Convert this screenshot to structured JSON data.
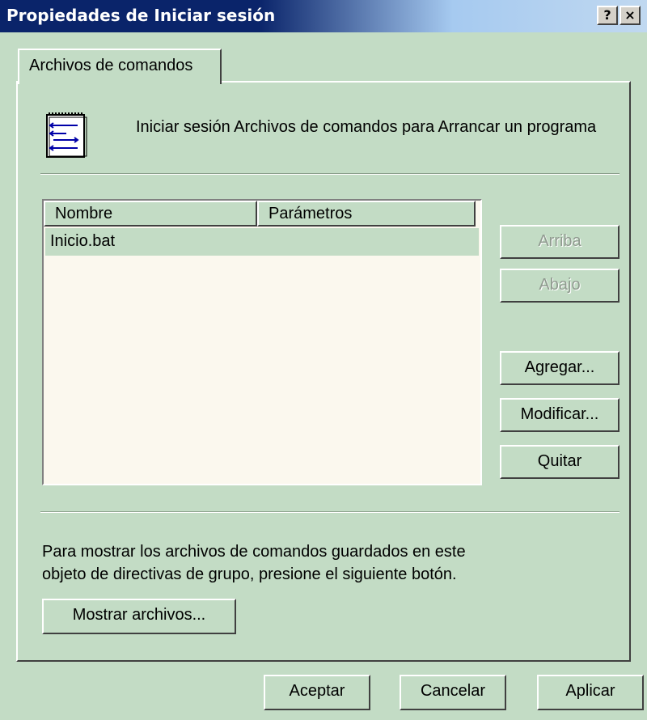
{
  "window": {
    "title": "Propiedades de Iniciar sesión",
    "help_label": "?",
    "close_label": "×"
  },
  "tab": {
    "label": "Archivos de comandos"
  },
  "header": {
    "icon": "script-list-icon",
    "text": "Iniciar sesión Archivos de comandos para Arrancar un programa"
  },
  "list": {
    "columns": [
      "Nombre",
      "Parámetros"
    ],
    "rows": [
      {
        "name": "Inicio.bat",
        "params": ""
      }
    ]
  },
  "side_buttons": {
    "up": "Arriba",
    "down": "Abajo",
    "add": "Agregar...",
    "edit": "Modificar...",
    "remove": "Quitar"
  },
  "footer": {
    "text_line1": "Para mostrar los archivos de comandos guardados en este",
    "text_line2": "objeto de directivas de grupo, presione el siguiente botón.",
    "show_files": "Mostrar archivos..."
  },
  "dialog_buttons": {
    "ok": "Aceptar",
    "cancel": "Cancelar",
    "apply": "Aplicar"
  }
}
